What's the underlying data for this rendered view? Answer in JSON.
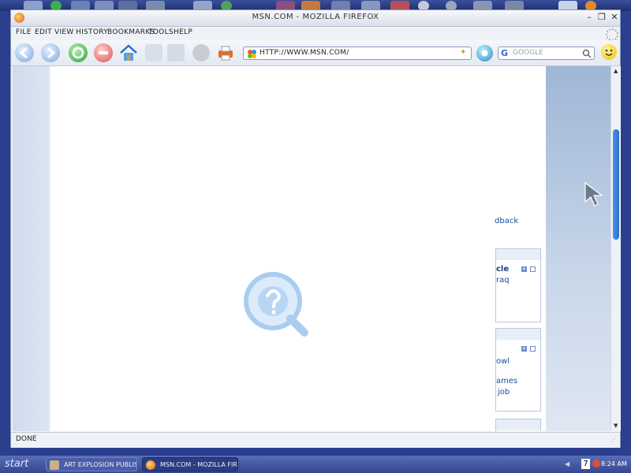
{
  "window": {
    "title": "MSN.COM - MOZILLA FIREFOX"
  },
  "menu": [
    "FILE",
    "EDIT",
    "VIEW",
    "HISTORY",
    "BOOKMARKS",
    "TOOLS",
    "HELP"
  ],
  "toolbar": {
    "url": "HTTP://WWW.MSN.COM/",
    "search_placeholder": "GOOGLE"
  },
  "page": {
    "feedback_fragment": "dback",
    "panel1": {
      "line1": "cle",
      "line2": "raq"
    },
    "panel2": {
      "line1": "owl",
      "line2": "ames",
      "line3": "job"
    }
  },
  "status": "DONE",
  "taskbar": {
    "start": "start",
    "tasks": [
      "ART EXPLOSION PUBLISHER PRO ...",
      "MSN.COM - MOZILLA FIREFOX"
    ],
    "tray_number": "7",
    "clock": "8:24 AM"
  },
  "colors": {
    "accent": "#2e6fd0",
    "link": "#1a4fa0",
    "taskbar": "#34478f"
  }
}
